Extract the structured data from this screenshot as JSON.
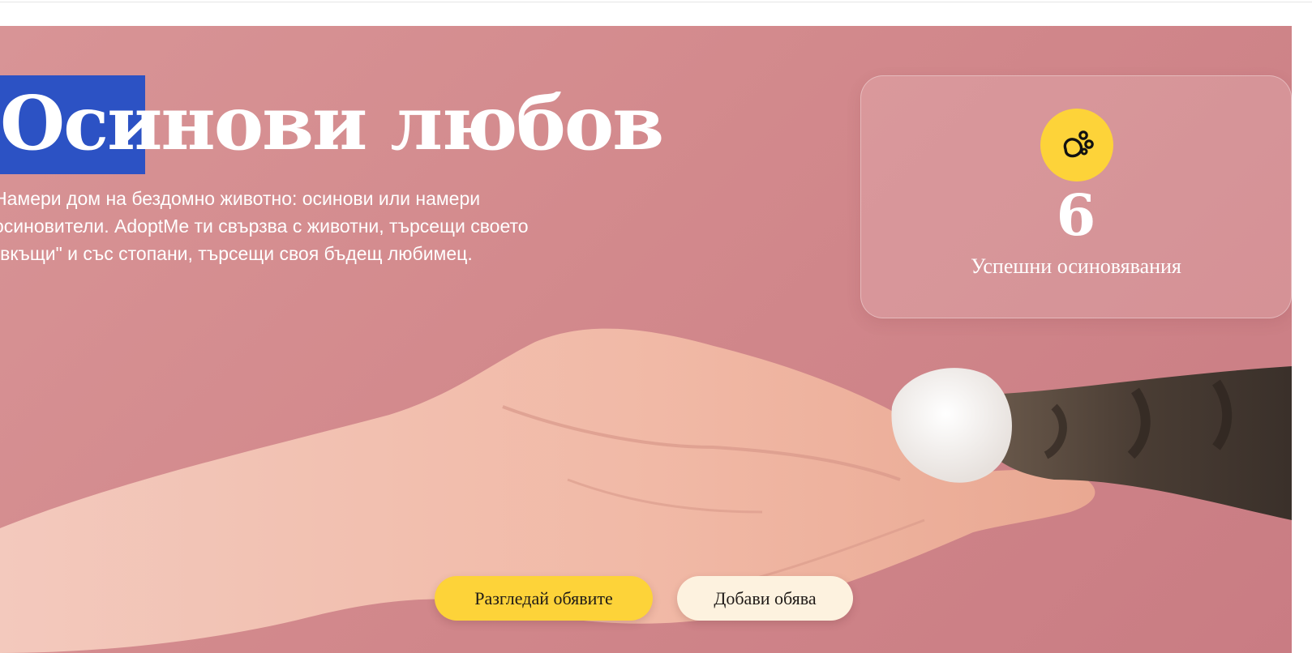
{
  "hero": {
    "title": "Осинови любов",
    "description": "Намери дом на бездомно животно: осинови или намери осиновители. AdoptMe ти свързва с животни, търсещи своето \"вкъщи\" и със стопани, търсещи своя бъдещ любимец.",
    "background_color": "#d38a8d"
  },
  "stats": {
    "icon": "paw-icon",
    "count": "6",
    "label": "Успешни осиновявания",
    "badge_color": "#fdd339"
  },
  "actions": {
    "browse_label": "Разгледай обявите",
    "add_label": "Добави обява",
    "primary_color": "#fdd339",
    "secondary_color": "#fdf2df"
  },
  "selection_color": "#2c52c4"
}
